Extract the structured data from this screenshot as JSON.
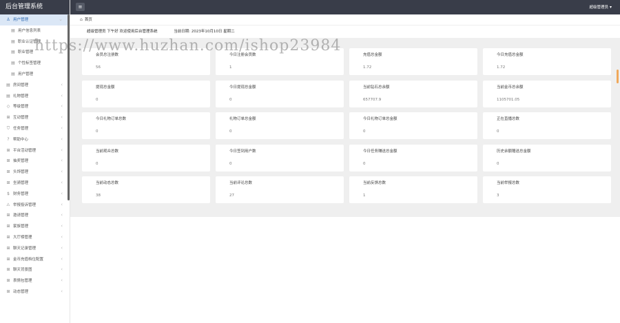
{
  "app": {
    "title": "后台管理系统"
  },
  "topbar": {
    "user": "超级管理员"
  },
  "breadcrumb": {
    "home": "首页"
  },
  "welcome": {
    "greeting": "超级管理员 下午好 欢迎使用后台管理系统",
    "date": "当前日期: 2023年10月10日 星期二"
  },
  "watermark": "https://www.huzhan.com/ishop23984",
  "sidebar": {
    "items": [
      {
        "label": "用户管理",
        "icon": "user-icon",
        "active": true,
        "sub": false,
        "chevron": "﹀"
      },
      {
        "label": "用户信息列表",
        "sub": true
      },
      {
        "label": "职业认证管理",
        "sub": true
      },
      {
        "label": "职业管理",
        "sub": true
      },
      {
        "label": "个性标签管理",
        "sub": true
      },
      {
        "label": "用户管理",
        "sub": true
      },
      {
        "label": "房间管理",
        "icon": "file-icon",
        "chevron": "<"
      },
      {
        "label": "礼物管理",
        "icon": "file-icon",
        "chevron": "<"
      },
      {
        "label": "等级管理",
        "icon": "diamond-icon",
        "chevron": "<"
      },
      {
        "label": "互动管理",
        "icon": "grid-icon",
        "chevron": "<"
      },
      {
        "label": "任务管理",
        "icon": "shield-icon",
        "chevron": "<"
      },
      {
        "label": "帮助中心",
        "icon": "help-icon",
        "chevron": "<"
      },
      {
        "label": "平台活动管理",
        "icon": "grid-icon",
        "chevron": "<"
      },
      {
        "label": "抽奖管理",
        "icon": "grid-icon",
        "chevron": "<"
      },
      {
        "label": "头饰管理",
        "icon": "grid-icon",
        "chevron": "<"
      },
      {
        "label": "坐骑管理",
        "icon": "grid-icon",
        "chevron": "<"
      },
      {
        "label": "财务管理",
        "icon": "money-icon",
        "chevron": "<"
      },
      {
        "label": "举报投诉管理",
        "icon": "warning-icon",
        "chevron": "<"
      },
      {
        "label": "邀请管理",
        "icon": "grid-icon",
        "chevron": "<"
      },
      {
        "label": "家族管理",
        "icon": "grid-icon",
        "chevron": "<"
      },
      {
        "label": "大厅榜管理",
        "icon": "grid-icon",
        "chevron": "<"
      },
      {
        "label": "聊天记录管理",
        "icon": "grid-icon",
        "chevron": "<"
      },
      {
        "label": "金币充值档位配置",
        "icon": "grid-icon",
        "chevron": "<"
      },
      {
        "label": "聊天背景图",
        "icon": "grid-icon",
        "chevron": "<"
      },
      {
        "label": "表情包管理",
        "icon": "grid-icon",
        "chevron": "<"
      },
      {
        "label": "动态管理",
        "icon": "grid-icon",
        "chevron": "<"
      }
    ]
  },
  "stats": [
    {
      "label": "会员总注册数",
      "value": "56"
    },
    {
      "label": "今日注册会员数",
      "value": "1"
    },
    {
      "label": "充值总金额",
      "value": "1.72"
    },
    {
      "label": "今日充值总金额",
      "value": "1.72"
    },
    {
      "label": "提现总金额",
      "value": "0"
    },
    {
      "label": "今日提现总金额",
      "value": "0"
    },
    {
      "label": "当前钻石总余额",
      "value": "657707.9"
    },
    {
      "label": "当前金币总余额",
      "value": "1105701.05"
    },
    {
      "label": "今日礼物订单总数",
      "value": "0"
    },
    {
      "label": "礼物订单总金额",
      "value": "0"
    },
    {
      "label": "今日礼物订单总金额",
      "value": "0"
    },
    {
      "label": "正在直播总数",
      "value": "0"
    },
    {
      "label": "当前观众总数",
      "value": "0"
    },
    {
      "label": "今日签到用户数",
      "value": "0"
    },
    {
      "label": "今日任务赚送总金额",
      "value": "0"
    },
    {
      "label": "历史余额赠送总金额",
      "value": "0"
    },
    {
      "label": "当前动态总数",
      "value": "38"
    },
    {
      "label": "当前评论总数",
      "value": "27"
    },
    {
      "label": "当前反馈总数",
      "value": "1"
    },
    {
      "label": "当前举报总数",
      "value": "3"
    }
  ]
}
